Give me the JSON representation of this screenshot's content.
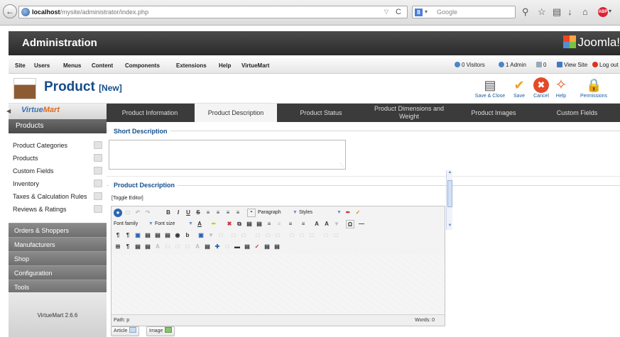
{
  "browser": {
    "url_host": "localhost",
    "url_path": "/mysite/administrator/index.php",
    "search_engine": "8",
    "search_placeholder": "Google"
  },
  "header": {
    "title": "Administration",
    "logo_text": "Joomla!"
  },
  "menu": {
    "items": [
      "Site",
      "Users",
      "Menus",
      "Content",
      "Components",
      "Extensions",
      "Help",
      "VirtueMart"
    ],
    "status": {
      "visitors": "0 Visitors",
      "admins": "1 Admin",
      "messages": "0",
      "view_site": "View Site",
      "logout": "Log out"
    }
  },
  "title_bar": {
    "title": "Product",
    "subtitle": "[New]",
    "buttons": [
      {
        "label": "Save & Close",
        "icon": "save-close-icon"
      },
      {
        "label": "Save",
        "icon": "save-icon"
      },
      {
        "label": "Cancel",
        "icon": "cancel-icon"
      },
      {
        "label": "Help",
        "icon": "help-icon"
      },
      {
        "label": "Permissions",
        "icon": "permissions-icon"
      }
    ]
  },
  "sidebar": {
    "logo": {
      "part1": "Virtue",
      "part2": "Mart"
    },
    "active_section": "Products",
    "links": [
      "Product Categories",
      "Products",
      "Custom Fields",
      "Inventory",
      "Taxes & Calculation Rules",
      "Reviews & Ratings"
    ],
    "sections": [
      "Orders & Shoppers",
      "Manufacturers",
      "Shop",
      "Configuration",
      "Tools"
    ],
    "version": "VirtueMart 2.6.6"
  },
  "tabs": [
    {
      "label": "Product Information",
      "active": false
    },
    {
      "label": "Product Description",
      "active": true
    },
    {
      "label": "Product Status",
      "active": false
    },
    {
      "label": "Product Dimensions and Weight",
      "active": false
    },
    {
      "label": "Product Images",
      "active": false
    },
    {
      "label": "Custom Fields",
      "active": false
    }
  ],
  "content": {
    "short_description_title": "Short Description",
    "short_description_value": "",
    "product_description_title": "Product Description",
    "toggle_editor": "[Toggle Editor]"
  },
  "editor": {
    "paragraph_label": "Paragraph",
    "styles_label": "Styles",
    "font_family_label": "Font family",
    "font_size_label": "Font size",
    "path_label": "Path: p",
    "words_label": "Words: 0"
  },
  "buttons": {
    "article": "Article",
    "image": "Image"
  },
  "colors": {
    "header_bg": "#333333",
    "accent": "#134c8a",
    "tab_bar": "#3b3b3b",
    "sidebar_section": "#7b7b7b"
  }
}
